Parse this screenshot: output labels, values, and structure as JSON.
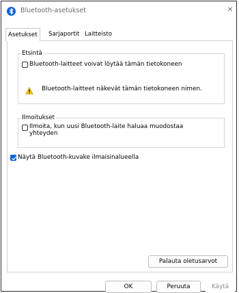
{
  "window": {
    "title": "Bluetooth-asetukset",
    "close_glyph": "✕"
  },
  "tabs": [
    {
      "label": "Asetukset",
      "active": true
    },
    {
      "label": "Sarjaportit",
      "active": false
    },
    {
      "label": "Laitteisto",
      "active": false
    }
  ],
  "discovery": {
    "group_label": "Etsintä",
    "allow_discovery_label": "Bluetooth-laitteet voivat löytää tämän tietokoneen",
    "allow_discovery_checked": false,
    "warning_text": "Bluetooth-laitteet näkevät tämän tietokoneen nimen."
  },
  "notifications": {
    "group_label": "Ilmoitukset",
    "alert_label_line1": "Ilmoita, kun uusi Bluetooth-laite haluaa muodostaa",
    "alert_label_line2": "yhteyden",
    "alert_checked": false
  },
  "tray_icon": {
    "label": "Näytä Bluetooth-kuvake ilmaisinalueella",
    "checked": true
  },
  "buttons": {
    "restore_defaults": "Palauta oletusarvot",
    "ok": "OK",
    "cancel": "Peruuta",
    "apply": "Käytä"
  },
  "colors": {
    "accent": "#0a63d8",
    "warning": "#f2c200"
  },
  "icons": {
    "title": "bluetooth-icon",
    "warning": "warning-icon",
    "check": "checkmark-icon"
  }
}
